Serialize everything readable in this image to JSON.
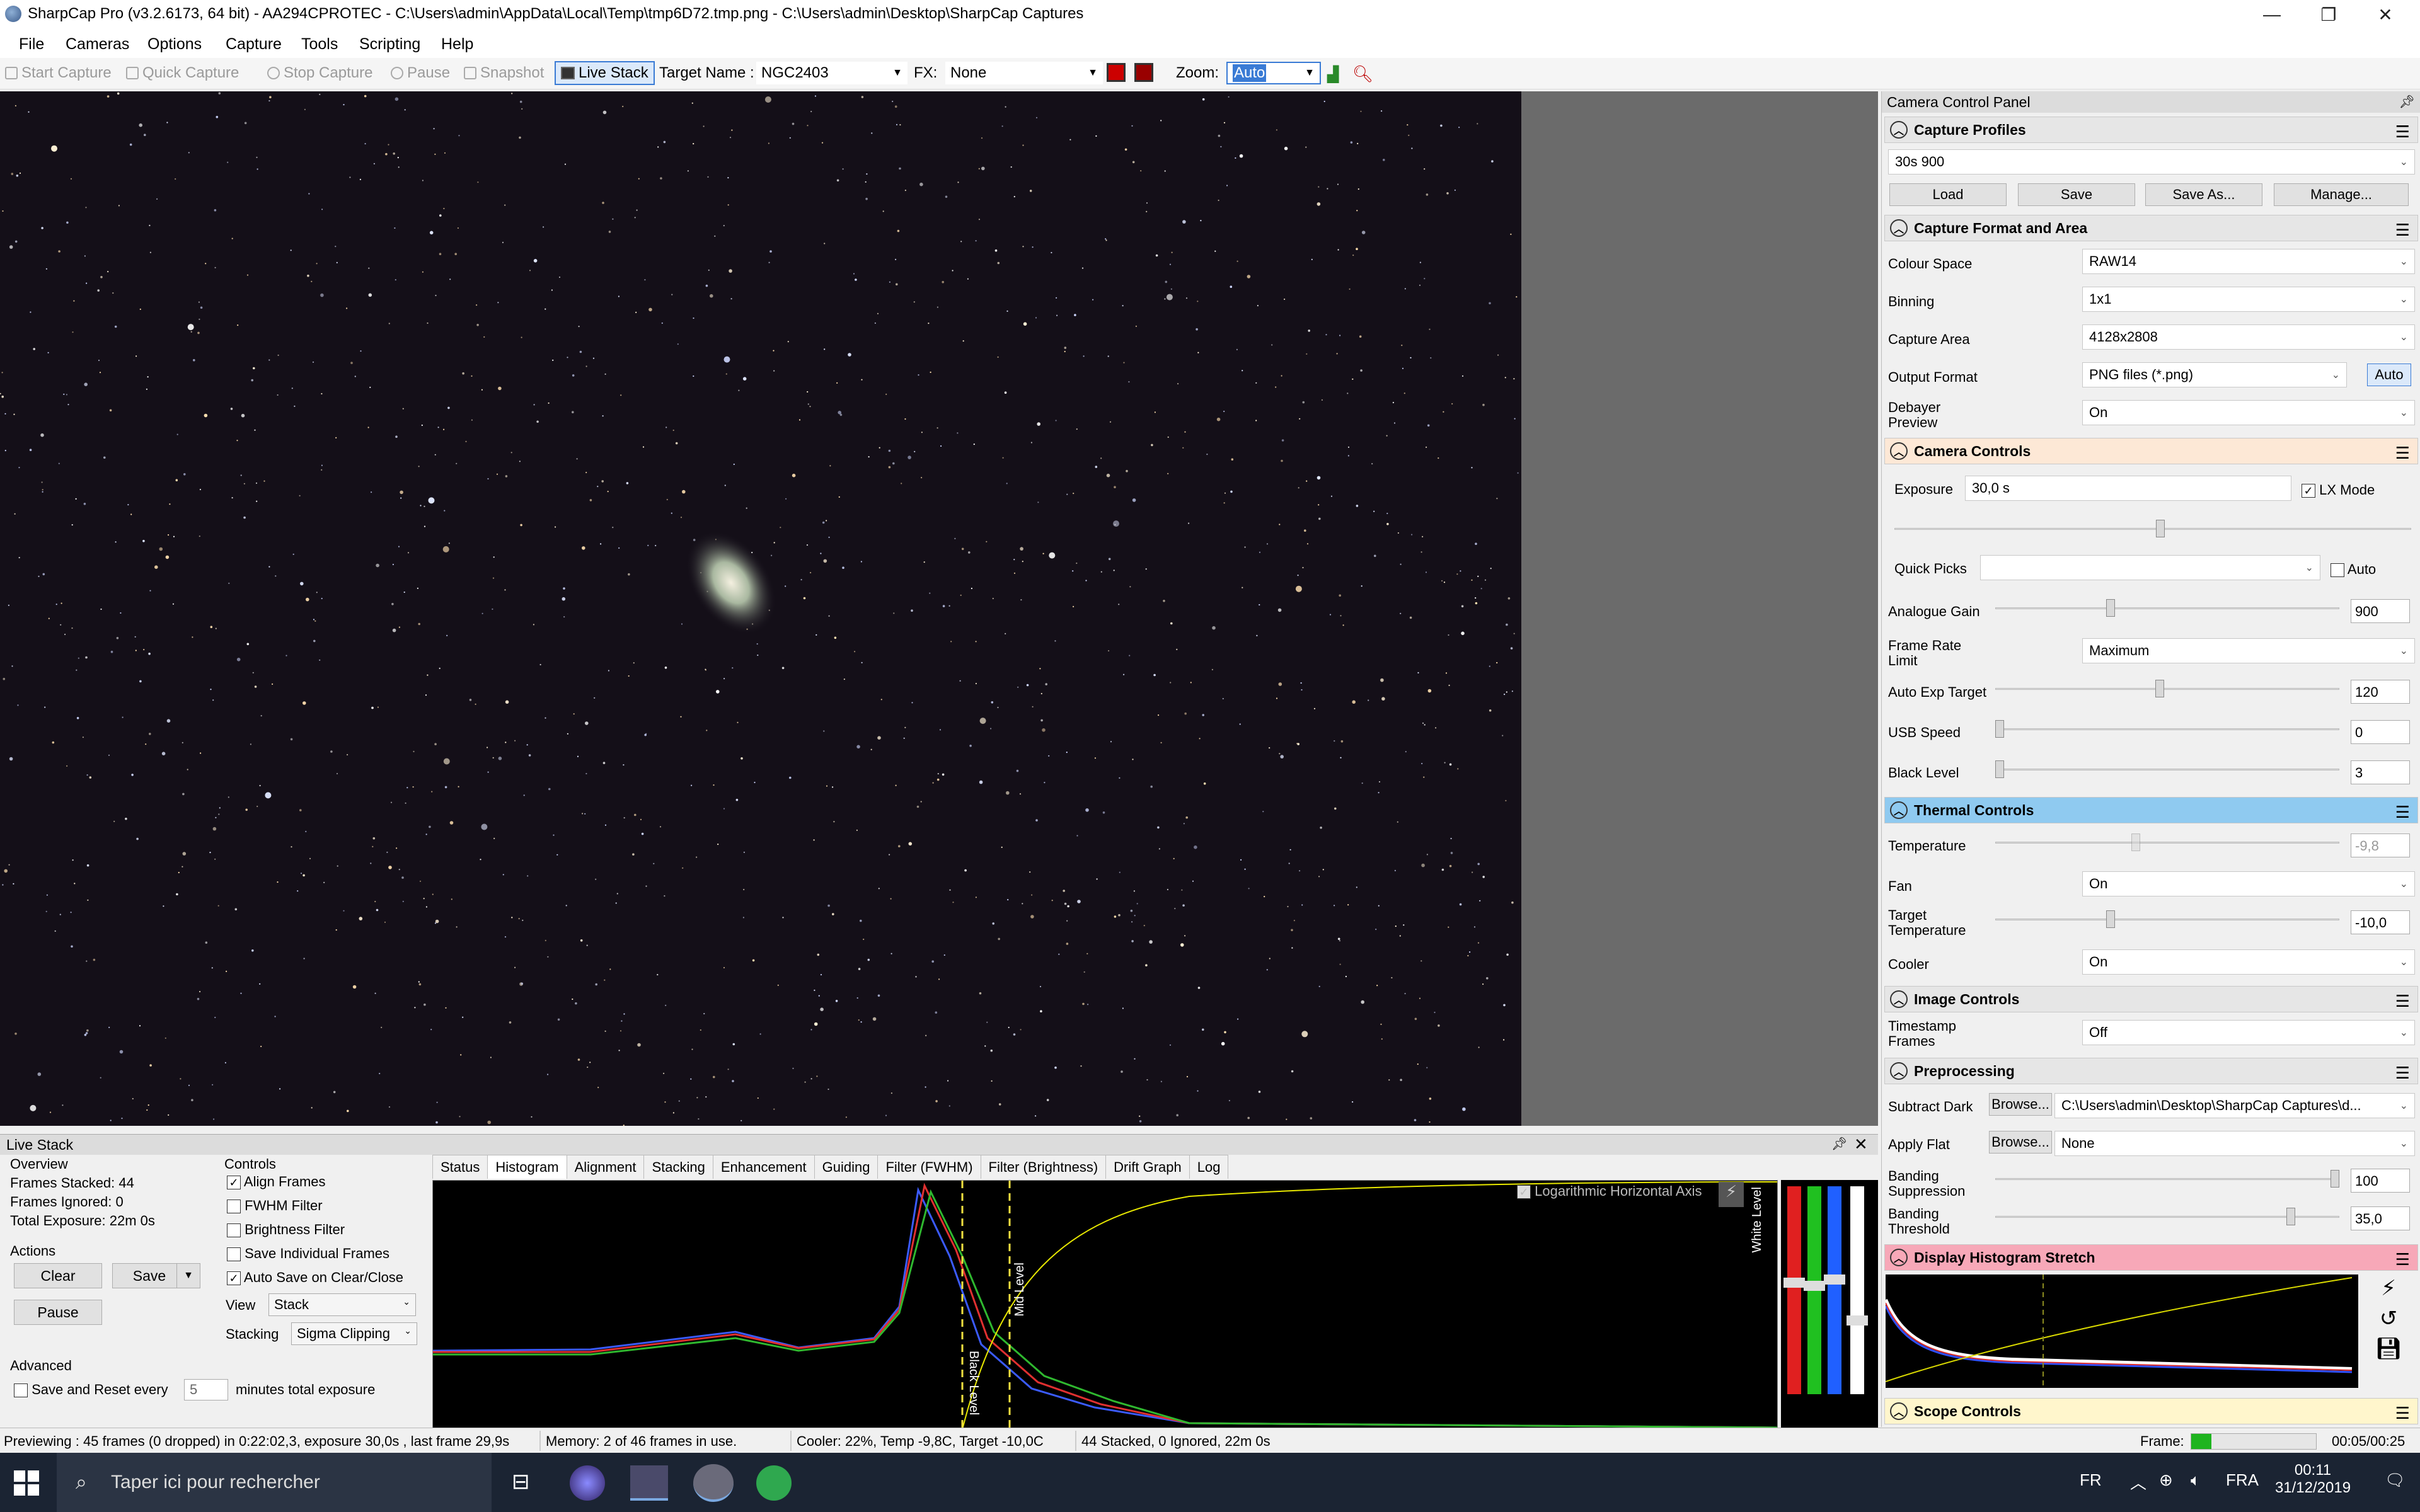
{
  "window": {
    "title": "SharpCap Pro (v3.2.6173, 64 bit) - AA294CPROTEC - C:\\Users\\admin\\AppData\\Local\\Temp\\tmp6D72.tmp.png - C:\\Users\\admin\\Desktop\\SharpCap Captures",
    "minimize": "—",
    "maximize": "❐",
    "close": "✕"
  },
  "menu": [
    "File",
    "Cameras",
    "Options",
    "Capture",
    "Tools",
    "Scripting",
    "Help"
  ],
  "toolbar": {
    "start_capture": "Start Capture",
    "quick_capture": "Quick Capture",
    "stop_capture": "Stop Capture",
    "pause": "Pause",
    "snapshot": "Snapshot",
    "live_stack": "Live Stack",
    "target_name_label": "Target Name :",
    "target_name": "NGC2403",
    "fx_label": "FX:",
    "fx_value": "None",
    "zoom_label": "Zoom:",
    "zoom_value": "Auto"
  },
  "panel": {
    "title": "Camera Control Panel",
    "sections": {
      "capture_profiles": "Capture Profiles",
      "capture_format": "Capture Format and Area",
      "camera_controls": "Camera Controls",
      "thermal_controls": "Thermal Controls",
      "image_controls": "Image Controls",
      "preprocessing": "Preprocessing",
      "display_histogram": "Display Histogram Stretch",
      "scope_controls": "Scope Controls"
    },
    "profile": "30s 900",
    "profile_buttons": [
      "Load",
      "Save",
      "Save As...",
      "Manage..."
    ],
    "colour_space_label": "Colour Space",
    "colour_space": "RAW14",
    "binning_label": "Binning",
    "binning": "1x1",
    "capture_area_label": "Capture Area",
    "capture_area": "4128x2808",
    "output_format_label": "Output Format",
    "output_format": "PNG files (*.png)",
    "output_auto": "Auto",
    "debayer_label": "Debayer Preview",
    "debayer": "On",
    "exposure_label": "Exposure",
    "exposure": "30,0 s",
    "lx_mode": "LX Mode",
    "quick_picks_label": "Quick Picks",
    "quick_picks_auto": "Auto",
    "gain_label": "Analogue Gain",
    "gain": "900",
    "frame_rate_label": "Frame Rate Limit",
    "frame_rate": "Maximum",
    "auto_exp_label": "Auto Exp Target",
    "auto_exp": "120",
    "usb_label": "USB Speed",
    "usb": "0",
    "black_label": "Black Level",
    "black": "3",
    "temperature_label": "Temperature",
    "temperature": "-9,8",
    "fan_label": "Fan",
    "fan": "On",
    "target_temp_label": "Target Temperature",
    "target_temp": "-10,0",
    "cooler_label": "Cooler",
    "cooler": "On",
    "timestamp_label": "Timestamp Frames",
    "timestamp": "Off",
    "subtract_dark_label": "Subtract Dark",
    "browse": "Browse...",
    "subtract_dark": "C:\\Users\\admin\\Desktop\\SharpCap Captures\\d...",
    "apply_flat_label": "Apply Flat",
    "apply_flat": "None",
    "banding_supp_label": "Banding Suppression",
    "banding_supp": "100",
    "banding_thresh_label": "Banding Threshold",
    "banding_thresh": "35,0"
  },
  "livestack": {
    "title": "Live Stack",
    "overview": "Overview",
    "frames_stacked": "Frames Stacked:  44",
    "frames_ignored": "Frames Ignored:   0",
    "total_exposure": "Total Exposure:   22m 0s",
    "actions": "Actions",
    "clear": "Clear",
    "save": "Save",
    "pause": "Pause",
    "advanced": "Advanced",
    "save_reset": "Save and Reset every",
    "minutes_value": "5",
    "minutes_label": "minutes total exposure",
    "controls": "Controls",
    "align_frames": "Align Frames",
    "fwhm_filter": "FWHM Filter",
    "brightness_filter": "Brightness Filter",
    "save_individual": "Save Individual Frames",
    "auto_save": "Auto Save on Clear/Close",
    "view_label": "View",
    "view": "Stack",
    "stacking_label": "Stacking",
    "stacking": "Sigma Clipping",
    "tabs": [
      "Status",
      "Histogram",
      "Alignment",
      "Stacking",
      "Enhancement",
      "Guiding",
      "Filter (FWHM)",
      "Filter (Brightness)",
      "Drift Graph",
      "Log"
    ],
    "log_axis": "Logarithmic Horizontal Axis",
    "black_level": "Black Level",
    "mid_level": "Mid Level",
    "white_level": "White Level"
  },
  "status": {
    "previewing": "Previewing : 45 frames (0 dropped) in 0:22:02,3, exposure 30,0s , last frame 29,9s",
    "memory": "Memory: 2 of 46 frames in use.",
    "cooler": "Cooler: 22%, Temp -9,8C, Target -10,0C",
    "stacked": "44 Stacked, 0 Ignored, 22m 0s",
    "frame_label": "Frame:",
    "time": "00:05/00:25"
  },
  "taskbar": {
    "search_placeholder": "Taper ici pour rechercher",
    "lang1": "FR",
    "lang2": "FRA",
    "clock_time": "00:11",
    "clock_date": "31/12/2019"
  },
  "colors": {
    "accent": "#3a7bd5",
    "camera_controls_header": "#fde8d6",
    "thermal_header": "#8fcaf0",
    "histogram_header": "#f7a8b8",
    "scope_header": "#fff6cc"
  }
}
